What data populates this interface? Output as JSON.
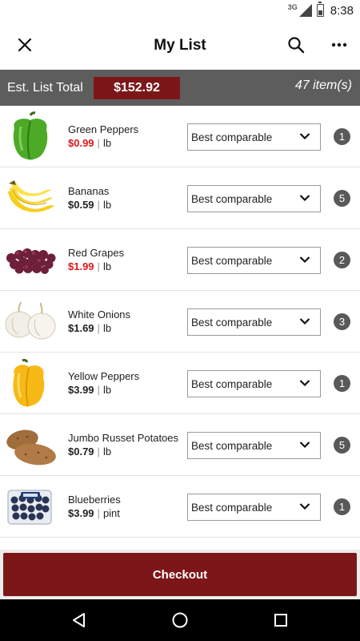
{
  "status_bar": {
    "network": "3G",
    "time": "8:38"
  },
  "header": {
    "title": "My List",
    "icons": [
      "close-icon",
      "search-icon",
      "more-icon"
    ]
  },
  "summary": {
    "label": "Est. List Total",
    "total": "$152.92",
    "item_count": "47 item(s)"
  },
  "items": [
    {
      "name": "Green Peppers",
      "price": "$0.99",
      "unit": "lb",
      "on_sale": true,
      "option": "Best comparable",
      "qty": "1",
      "image": "green-pepper"
    },
    {
      "name": "Bananas",
      "price": "$0.59",
      "unit": "lb",
      "on_sale": false,
      "option": "Best comparable",
      "qty": "5",
      "image": "banana"
    },
    {
      "name": "Red Grapes",
      "price": "$1.99",
      "unit": "lb",
      "on_sale": true,
      "option": "Best comparable",
      "qty": "2",
      "image": "red-grapes"
    },
    {
      "name": "White Onions",
      "price": "$1.69",
      "unit": "lb",
      "on_sale": false,
      "option": "Best comparable",
      "qty": "3",
      "image": "white-onion"
    },
    {
      "name": "Yellow Peppers",
      "price": "$3.99",
      "unit": "lb",
      "on_sale": false,
      "option": "Best comparable",
      "qty": "1",
      "image": "yellow-pepper"
    },
    {
      "name": "Jumbo Russet Potatoes",
      "price": "$0.79",
      "unit": "lb",
      "on_sale": false,
      "option": "Best comparable",
      "qty": "5",
      "image": "potato"
    },
    {
      "name": "Blueberries",
      "price": "$3.99",
      "unit": "pint",
      "on_sale": false,
      "option": "Best comparable",
      "qty": "1",
      "image": "blueberries"
    }
  ],
  "checkout": {
    "label": "Checkout"
  },
  "colors": {
    "brand": "#7d1619",
    "sale_price": "#d8171c",
    "summary_bar": "#5d5d5d",
    "qty_badge": "#595959"
  },
  "nav_bar": {
    "icons": [
      "back-icon",
      "home-icon",
      "recents-icon"
    ]
  }
}
